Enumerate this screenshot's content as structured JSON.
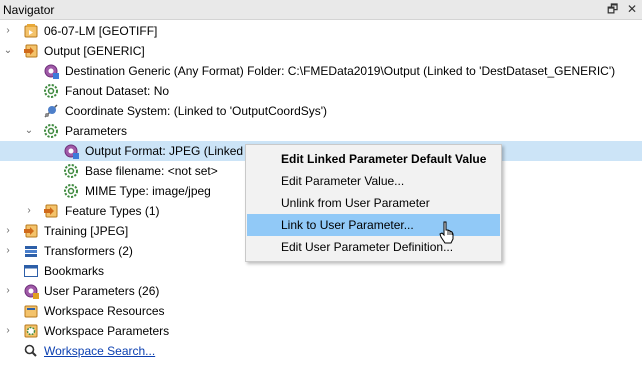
{
  "panel": {
    "title": "Navigator",
    "restore_glyph": "🗗",
    "close_glyph": "✕"
  },
  "tree": [
    {
      "label": "06-07-LM [GEOTIFF]",
      "icon": "reader-icon",
      "expander": "collapsed"
    },
    {
      "label": "Output [GENERIC]",
      "icon": "writer-icon",
      "expander": "expanded"
    },
    {
      "label": "Destination Generic (Any Format) Folder: C:\\FMEData2019\\Output (Linked to 'DestDataset_GENERIC')",
      "icon": "linked-parameter-icon"
    },
    {
      "label": "Fanout Dataset: No",
      "icon": "parameter-gear-icon"
    },
    {
      "label": "Coordinate System: (Linked to 'OutputCoordSys')",
      "icon": "coordinate-system-icon"
    },
    {
      "label": "Parameters",
      "icon": "parameter-gear-icon",
      "expander": "expanded"
    },
    {
      "label": "Output Format: JPEG (Linked t",
      "icon": "linked-parameter-icon",
      "selected": true
    },
    {
      "label": "Base filename: <not set>",
      "icon": "parameter-gear-icon"
    },
    {
      "label": "MIME Type: image/jpeg",
      "icon": "parameter-gear-icon"
    },
    {
      "label": "Feature Types (1)",
      "icon": "feature-types-icon",
      "expander": "collapsed"
    },
    {
      "label": "Training [JPEG]",
      "icon": "writer-icon",
      "expander": "collapsed"
    },
    {
      "label": "Transformers (2)",
      "icon": "transformers-icon",
      "expander": "collapsed"
    },
    {
      "label": "Bookmarks",
      "icon": "bookmark-icon"
    },
    {
      "label": "User Parameters (26)",
      "icon": "user-parameters-icon",
      "expander": "collapsed"
    },
    {
      "label": "Workspace Resources",
      "icon": "workspace-resources-icon"
    },
    {
      "label": "Workspace Parameters",
      "icon": "workspace-parameters-icon",
      "expander": "collapsed"
    },
    {
      "label": "Workspace Search...",
      "icon": "search-icon",
      "link": true
    }
  ],
  "context_menu": {
    "items": [
      {
        "label": "Edit Linked Parameter Default Value",
        "bold": true
      },
      {
        "label": "Edit Parameter Value..."
      },
      {
        "label": "Unlink from User Parameter"
      },
      {
        "label": "Link to User Parameter...",
        "highlighted": true
      },
      {
        "label": "Edit User Parameter Definition..."
      }
    ]
  },
  "colors": {
    "selection": "#cce4f7",
    "menu_highlight": "#91c9f7",
    "link": "#0b3fb0"
  }
}
